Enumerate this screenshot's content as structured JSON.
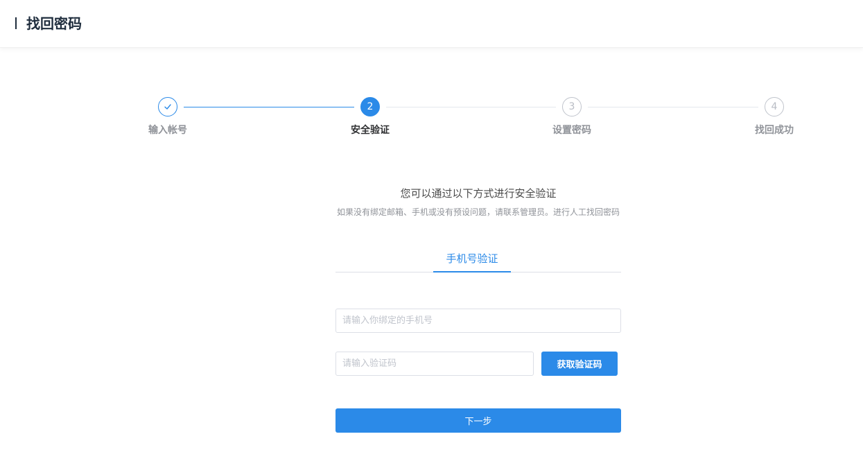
{
  "header": {
    "title": "找回密码"
  },
  "steps": [
    {
      "number": "",
      "label": "输入帐号",
      "status": "done",
      "icon": "check-icon"
    },
    {
      "number": "2",
      "label": "安全验证",
      "status": "active"
    },
    {
      "number": "3",
      "label": "设置密码",
      "status": "wait"
    },
    {
      "number": "4",
      "label": "找回成功",
      "status": "wait"
    }
  ],
  "intro": {
    "title": "您可以通过以下方式进行安全验证",
    "subtitle": "如果没有绑定邮箱、手机或没有预设问题，请联系管理员。进行人工找回密码"
  },
  "tabs": [
    {
      "label": "手机号验证",
      "active": true
    }
  ],
  "form": {
    "phone_placeholder": "请输入你绑定的手机号",
    "phone_value": "",
    "code_placeholder": "请输入验证码",
    "code_value": "",
    "get_code_label": "获取验证码",
    "next_label": "下一步"
  },
  "colors": {
    "primary": "#2b8ae8",
    "text_dark": "#1f2d3d",
    "border": "#dcdfe6"
  }
}
